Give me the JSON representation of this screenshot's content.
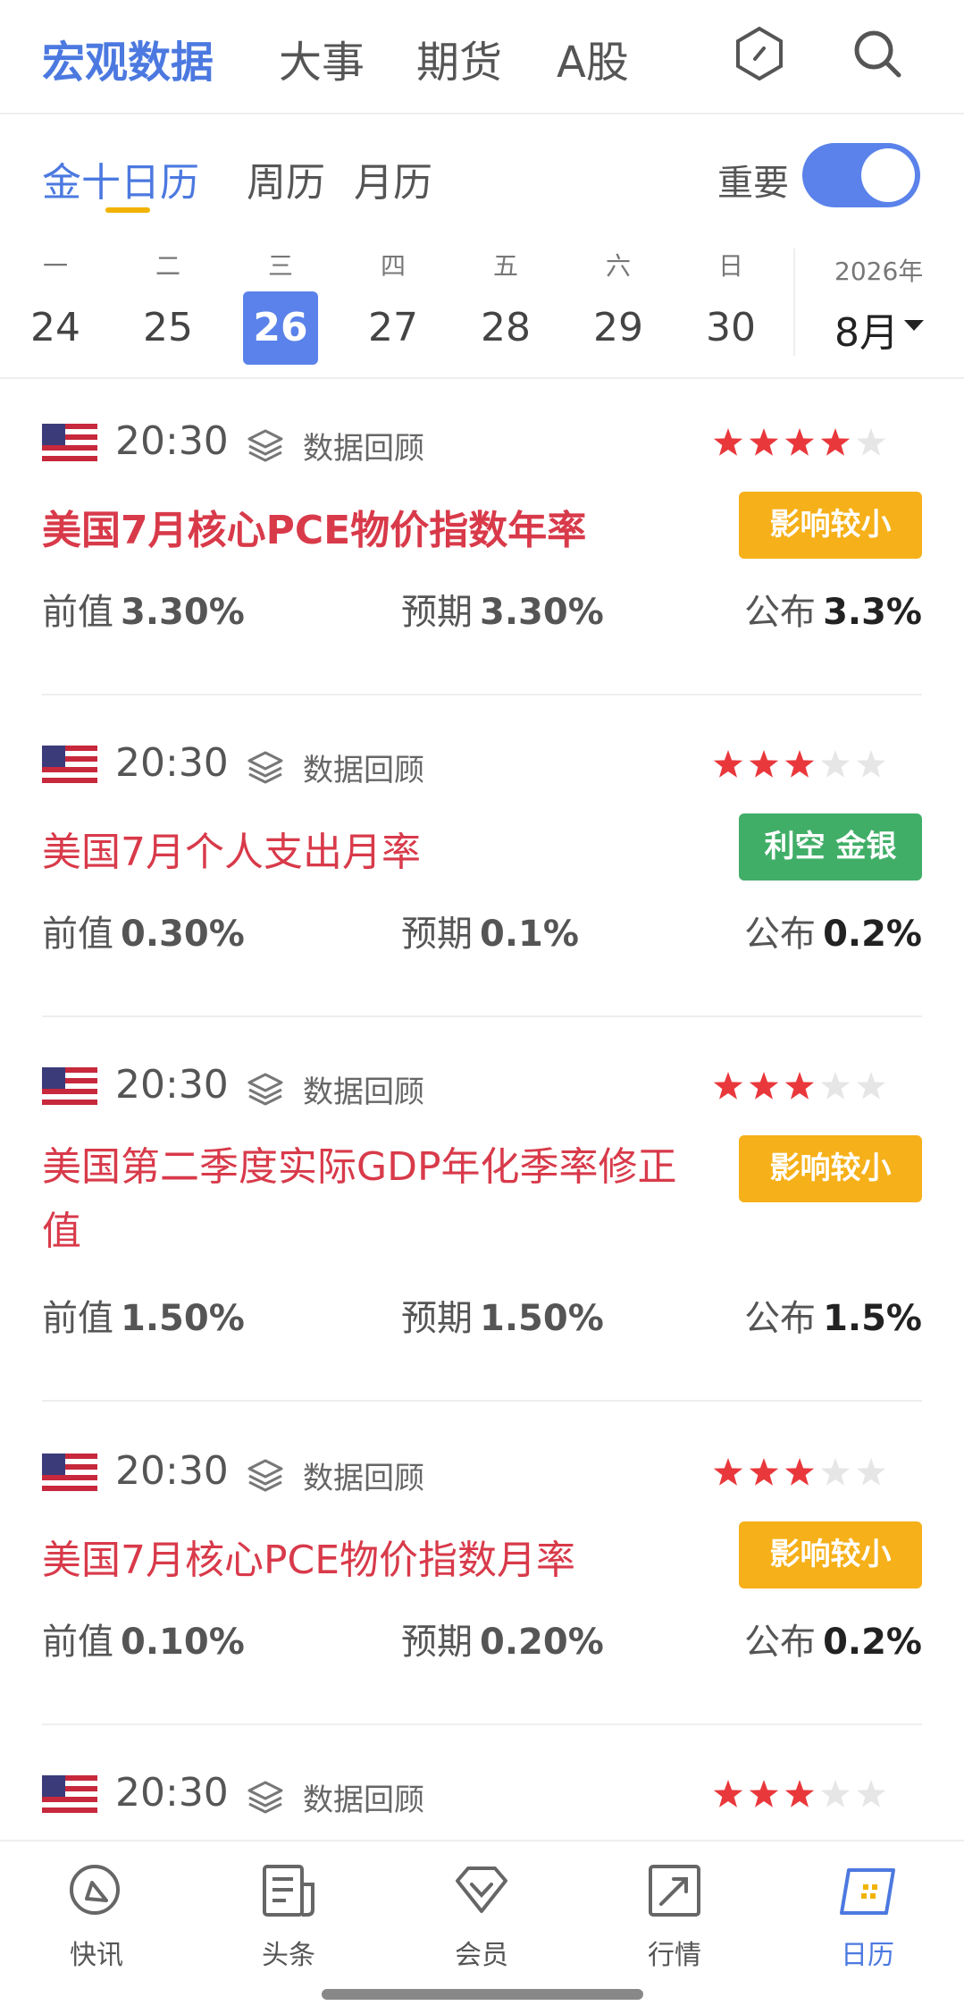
{
  "top_tabs": [
    "宏观数据",
    "大事",
    "期货",
    "A股"
  ],
  "sub_tabs": [
    "金十日历",
    "周历",
    "月历"
  ],
  "important_label": "重要",
  "important_on": true,
  "week": {
    "day_names": [
      "一",
      "二",
      "三",
      "四",
      "五",
      "六",
      "日"
    ],
    "dates": [
      "24",
      "25",
      "26",
      "27",
      "28",
      "29",
      "30"
    ],
    "selected_index": 2,
    "year": "2026年",
    "month": "8月"
  },
  "colors": {
    "accent": "#4c79e0",
    "title_red": "#d83a4a",
    "star_on": "#e9383c",
    "star_off": "#e6e6e6",
    "badge_orange": "#f6b019",
    "badge_green": "#41ae68"
  },
  "review_label": "数据回顾",
  "labels": {
    "prev": "前值",
    "forecast": "预期",
    "actual": "公布"
  },
  "events": [
    {
      "time": "20:30",
      "stars": 4,
      "title": "美国7月核心PCE物价指数年率",
      "title_bold": true,
      "badge": "影响较小",
      "badge_color": "orange",
      "prev": "3.30%",
      "forecast": "3.30%",
      "actual": "3.3%"
    },
    {
      "time": "20:30",
      "stars": 3,
      "title": "美国7月个人支出月率",
      "title_bold": false,
      "badge": "利空 金银",
      "badge_color": "green",
      "prev": "0.30%",
      "forecast": "0.1%",
      "actual": "0.2%"
    },
    {
      "time": "20:30",
      "stars": 3,
      "title": "美国第二季度实际GDP年化季率修正值",
      "title_bold": false,
      "badge": "影响较小",
      "badge_color": "orange",
      "prev": "1.50%",
      "forecast": "1.50%",
      "actual": "1.5%"
    },
    {
      "time": "20:30",
      "stars": 3,
      "title": "美国7月核心PCE物价指数月率",
      "title_bold": false,
      "badge": "影响较小",
      "badge_color": "orange",
      "prev": "0.10%",
      "forecast": "0.20%",
      "actual": "0.2%"
    },
    {
      "time": "20:30",
      "stars": 3
    }
  ],
  "bottom_nav": [
    "快讯",
    "头条",
    "会员",
    "行情",
    "日历"
  ],
  "bottom_nav_active": 4
}
